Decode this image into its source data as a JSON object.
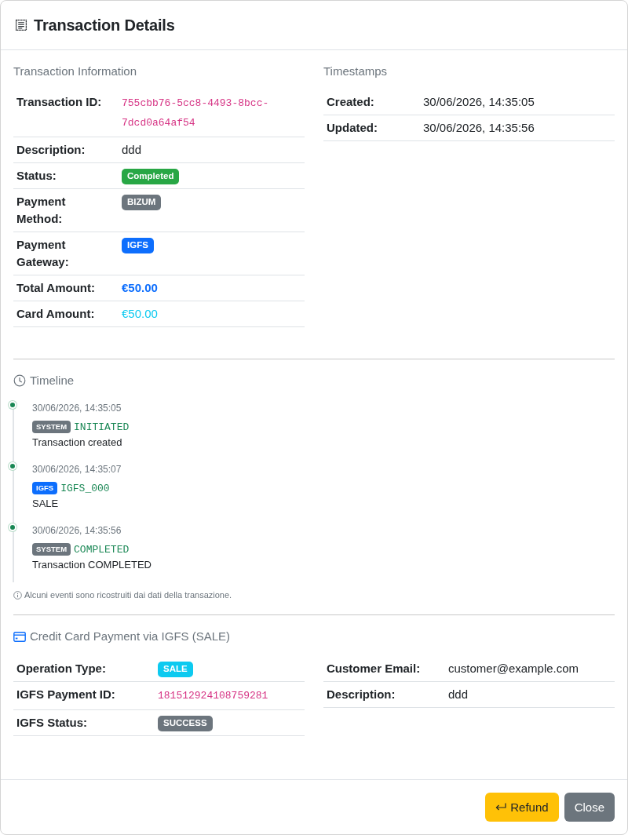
{
  "modal": {
    "title": "Transaction Details"
  },
  "transaction_info": {
    "heading": "Transaction Information",
    "rows": [
      {
        "label": "Transaction ID:",
        "kind": "code",
        "value": "755cbb76-5cc8-4493-8bcc-7dcd0a64af54"
      },
      {
        "label": "Description:",
        "kind": "text",
        "value": "ddd"
      },
      {
        "label": "Status:",
        "kind": "badge",
        "value": "Completed",
        "color": "#28a745"
      },
      {
        "label": "Payment Method:",
        "kind": "badge",
        "value": "BIZUM",
        "color": "#6c757d"
      },
      {
        "label": "Payment Gateway:",
        "kind": "badge",
        "value": "IGFS",
        "color": "#0d6efd"
      },
      {
        "label": "Total Amount:",
        "kind": "amount",
        "value": "€50.00",
        "color": "#0d6efd",
        "strong": true
      },
      {
        "label": "Card Amount:",
        "kind": "amount",
        "value": "€50.00",
        "color": "#0dcaf0",
        "strong": false
      }
    ]
  },
  "timestamps": {
    "heading": "Timestamps",
    "rows": [
      {
        "label": "Created:",
        "kind": "text",
        "value": "30/06/2026, 14:35:05"
      },
      {
        "label": "Updated:",
        "kind": "text",
        "value": "30/06/2026, 14:35:56"
      }
    ]
  },
  "timeline": {
    "heading": "Timeline",
    "events": [
      {
        "time": "30/06/2026, 14:35:05",
        "source": "SYSTEM",
        "color": "#6c757d",
        "code": "INITIATED",
        "description": "Transaction created"
      },
      {
        "time": "30/06/2026, 14:35:07",
        "source": "IGFS",
        "color": "#0d6efd",
        "code": "IGFS_000",
        "description": "SALE"
      },
      {
        "time": "30/06/2026, 14:35:56",
        "source": "SYSTEM",
        "color": "#6c757d",
        "code": "COMPLETED",
        "description": "Transaction COMPLETED"
      }
    ],
    "note": "Alcuni eventi sono ricostruiti dai dati della transazione."
  },
  "payment": {
    "heading": "Credit Card Payment via IGFS (SALE)",
    "left_rows": [
      {
        "label": "Operation Type:",
        "kind": "badge",
        "value": "SALE",
        "color": "#0dcaf0"
      },
      {
        "label": "IGFS Payment ID:",
        "kind": "code",
        "value": "181512924108759281"
      },
      {
        "label": "IGFS Status:",
        "kind": "badge",
        "value": "SUCCESS",
        "color": "#6c757d"
      }
    ],
    "right_rows": [
      {
        "label": "Customer Email:",
        "kind": "text",
        "value": "customer@example.com"
      },
      {
        "label": "Description:",
        "kind": "text",
        "value": "ddd"
      }
    ]
  },
  "buttons": [
    {
      "label": "Refund",
      "kind": "warning"
    },
    {
      "label": "Close",
      "kind": "secondary"
    }
  ]
}
